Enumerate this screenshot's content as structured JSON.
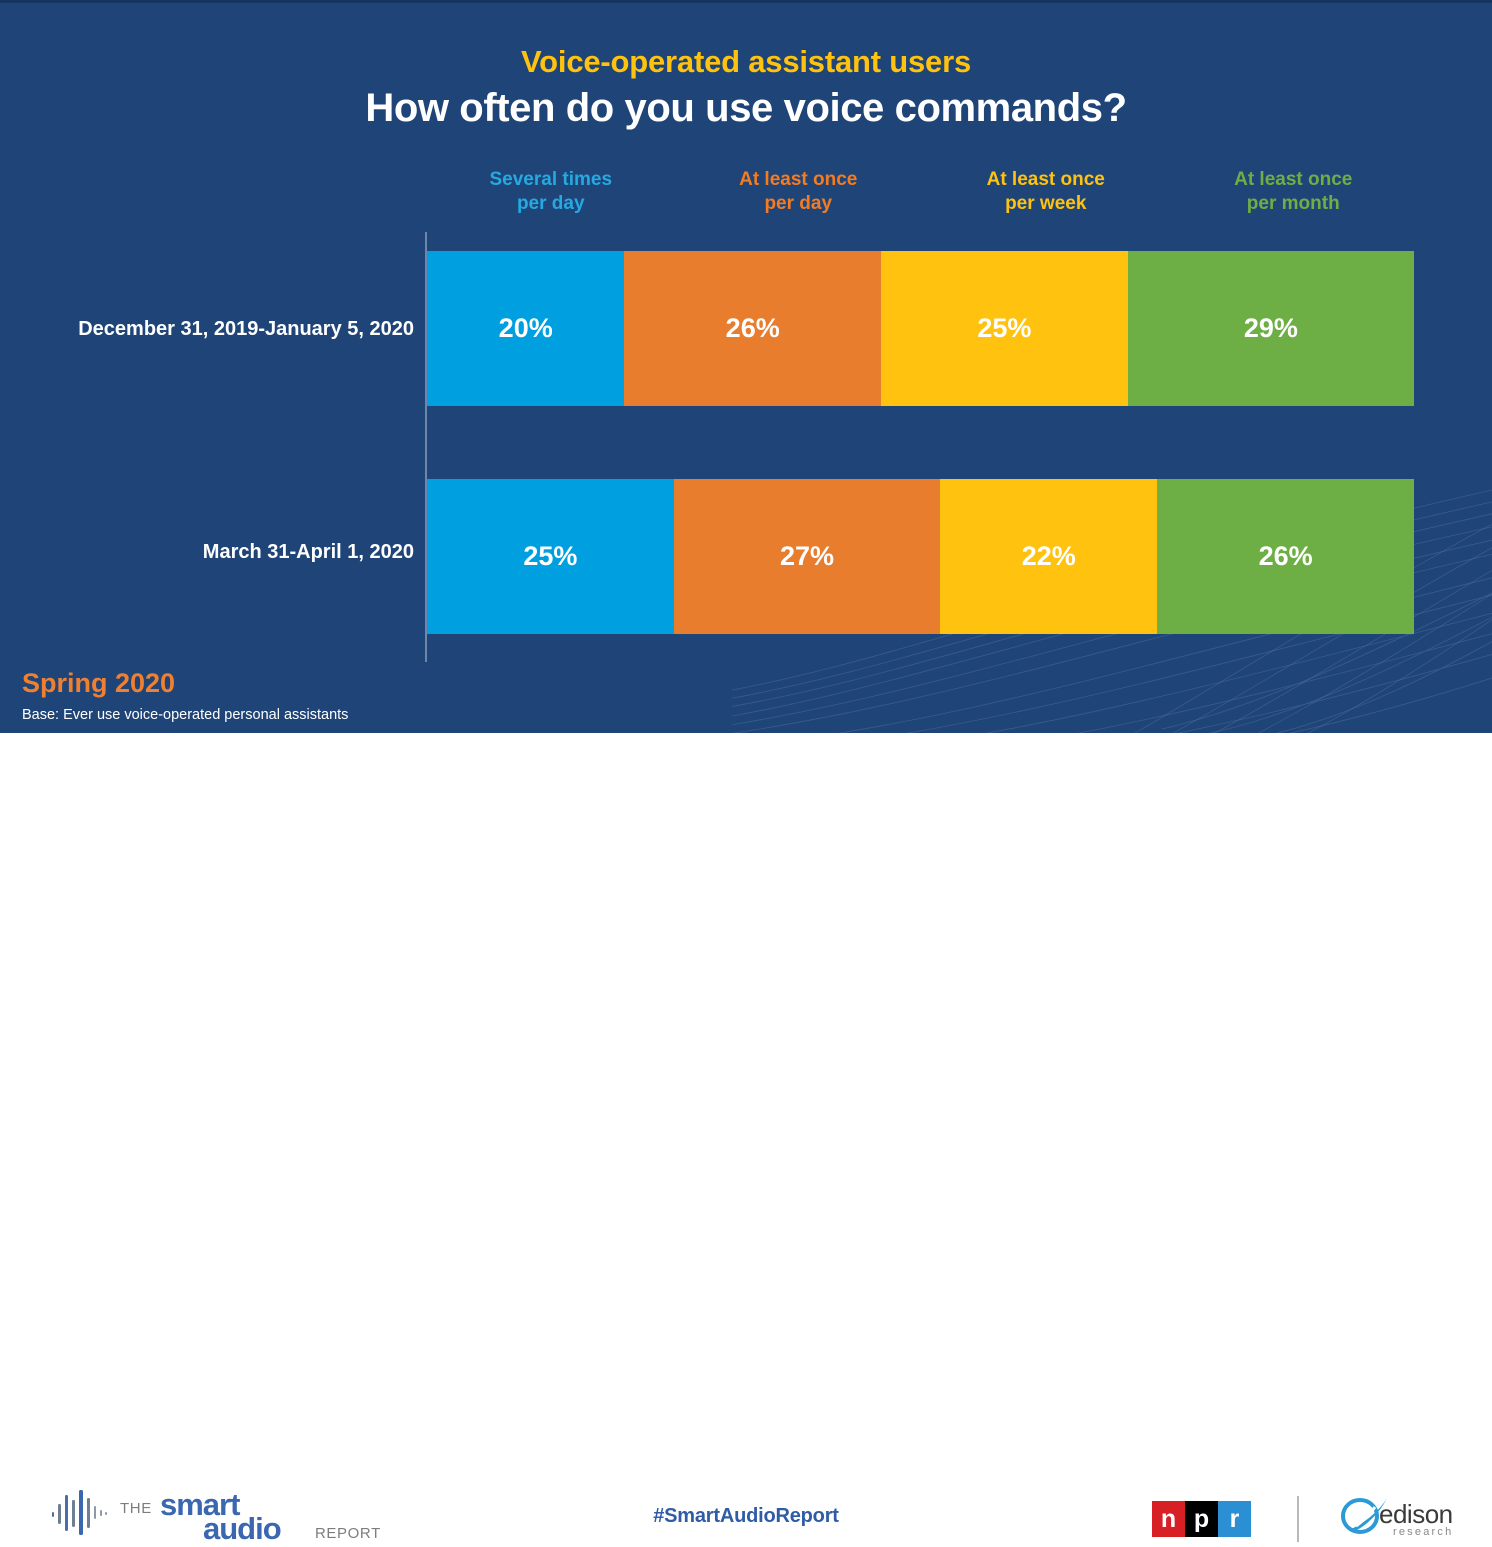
{
  "slide": {
    "eyebrow": "Voice-operated assistant users",
    "title": "How often do you use voice commands?",
    "season": "Spring 2020",
    "base_note": "Base: Ever use voice-operated personal assistants",
    "background_color": "#1f4578"
  },
  "footer": {
    "logo_the": "THE",
    "logo_smart": "smart",
    "logo_audio": "audio",
    "logo_report": "REPORT",
    "hashtag": "#SmartAudioReport",
    "npr": [
      "n",
      "p",
      "r"
    ],
    "edison_name": "edison",
    "edison_sub": "research"
  },
  "chart_data": {
    "type": "bar",
    "subtype": "100% stacked horizontal",
    "title": "How often do you use voice commands?",
    "subtitle": "Voice-operated assistant users",
    "xlabel": "",
    "ylabel": "",
    "grid": false,
    "legend_position": "top",
    "categories": [
      "December 31, 2019-January 5, 2020",
      "March 31-April 1, 2020"
    ],
    "series": [
      {
        "name": "Several times per day",
        "color": "#009fe0",
        "values": [
          20,
          25
        ],
        "labels": [
          "20%",
          "25%"
        ]
      },
      {
        "name": "At least once per day",
        "color": "#e87d2e",
        "values": [
          26,
          27
        ],
        "labels": [
          "26%",
          "27%"
        ]
      },
      {
        "name": "At least once per week",
        "color": "#ffc20e",
        "values": [
          25,
          22
        ],
        "labels": [
          "25%",
          "22%"
        ]
      },
      {
        "name": "At least once per month",
        "color": "#6daf44",
        "values": [
          29,
          26
        ],
        "labels": [
          "29%",
          "26%"
        ]
      }
    ],
    "column_headers": [
      {
        "line1": "Several times",
        "line2": "per day",
        "color": "#25a9e0"
      },
      {
        "line1": "At least once",
        "line2": "per day",
        "color": "#f47b20"
      },
      {
        "line1": "At least once",
        "line2": "per week",
        "color": "#ffc20e"
      },
      {
        "line1": "At least once",
        "line2": "per month",
        "color": "#6daf44"
      }
    ]
  }
}
